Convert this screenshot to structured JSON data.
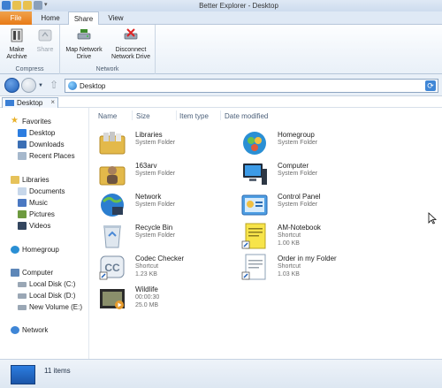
{
  "window": {
    "title": "Better Explorer - Desktop"
  },
  "ribbon": {
    "tabs": {
      "file": "File",
      "home": "Home",
      "share": "Share",
      "view": "View"
    },
    "groups": {
      "compress": {
        "label": "Compress",
        "make_archive": "Make Archive",
        "share": "Share"
      },
      "network": {
        "label": "Network",
        "map_drive": "Map Network Drive",
        "disconnect_drive": "Disconnect Network Drive"
      }
    }
  },
  "address": {
    "path": "Desktop"
  },
  "doc_tab": {
    "label": "Desktop",
    "close": "×"
  },
  "nav": {
    "favorites": {
      "label": "Favorites",
      "items": [
        "Desktop",
        "Downloads",
        "Recent Places"
      ]
    },
    "libraries": {
      "label": "Libraries",
      "items": [
        "Documents",
        "Music",
        "Pictures",
        "Videos"
      ]
    },
    "homegroup": "Homegroup",
    "computer": {
      "label": "Computer",
      "items": [
        "Local Disk (C:)",
        "Local Disk (D:)",
        "New Volume (E:)"
      ]
    },
    "network": "Network"
  },
  "columns": [
    "Name",
    "Size",
    "Item type",
    "Date modified"
  ],
  "files": [
    {
      "name": "Libraries",
      "type": "System Folder",
      "size": ""
    },
    {
      "name": "Homegroup",
      "type": "System Folder",
      "size": ""
    },
    {
      "name": "163arv",
      "type": "System Folder",
      "size": ""
    },
    {
      "name": "Computer",
      "type": "System Folder",
      "size": ""
    },
    {
      "name": "Network",
      "type": "System Folder",
      "size": ""
    },
    {
      "name": "Control Panel",
      "type": "System Folder",
      "size": ""
    },
    {
      "name": "Recycle Bin",
      "type": "System Folder",
      "size": ""
    },
    {
      "name": "AM-Notebook",
      "type": "Shortcut",
      "size": "1.00 KB"
    },
    {
      "name": "Codec Checker",
      "type": "Shortcut",
      "size": "1.23 KB"
    },
    {
      "name": "Order in my Folder",
      "type": "Shortcut",
      "size": "1.03 KB"
    },
    {
      "name": "Wildlife",
      "type": "00:00:30",
      "size": "25.0 MB"
    }
  ],
  "status": {
    "count": "11 items"
  }
}
